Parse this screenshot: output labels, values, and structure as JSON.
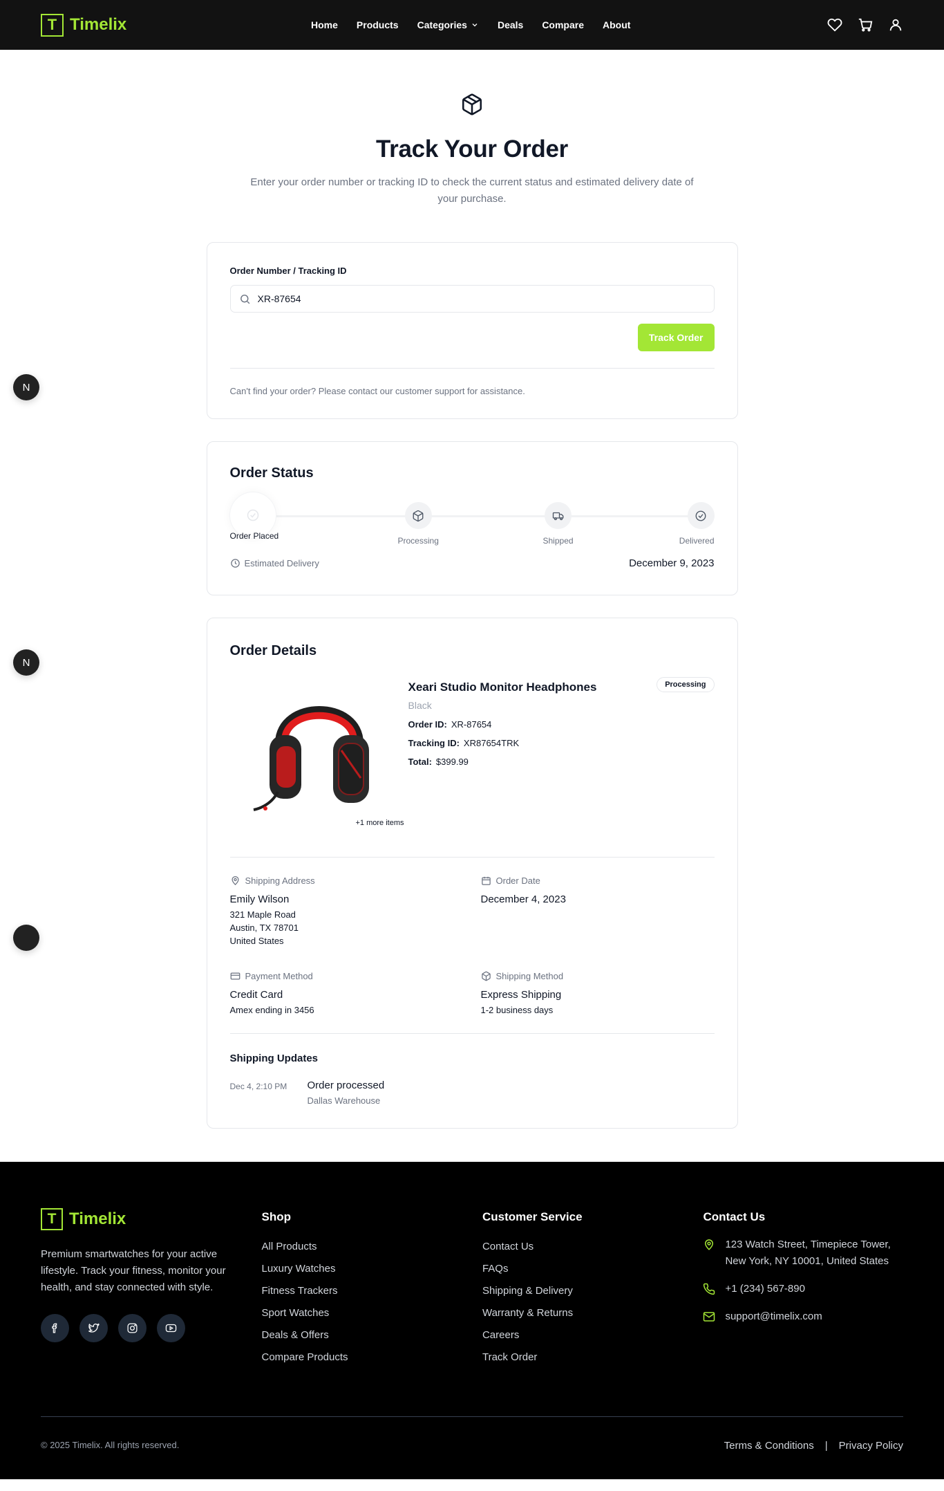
{
  "nav": {
    "brand_letter": "T",
    "brand_name": "Timelix",
    "links": [
      "Home",
      "Products",
      "Categories",
      "Deals",
      "Compare",
      "About"
    ],
    "icons": [
      "heart-icon",
      "cart-icon",
      "user-icon"
    ]
  },
  "hero": {
    "icon": "package-icon",
    "title": "Track Your Order",
    "subtitle": "Enter your order number or tracking ID to check the current status and estimated delivery date of your purchase."
  },
  "search": {
    "label": "Order Number / Tracking ID",
    "value": "XR-87654",
    "button": "Track Order",
    "help": "Can't find your order? Please contact our customer support for assistance."
  },
  "status": {
    "title": "Order Status",
    "steps": [
      "Order Placed",
      "Processing",
      "Shipped",
      "Delivered"
    ],
    "eta_label": "Estimated Delivery",
    "eta_date": "December 9, 2023"
  },
  "details": {
    "title": "Order Details",
    "product_name": "Xeari Studio Monitor Headphones",
    "variant": "Black",
    "badge": "Processing",
    "more_items": "+1 more items",
    "order_id_label": "Order ID:",
    "order_id": "XR-87654",
    "tracking_label": "Tracking ID:",
    "tracking_id": "XR87654TRK",
    "total_label": "Total:",
    "total": "$399.99",
    "shipping_address": {
      "label": "Shipping Address",
      "name": "Emily Wilson",
      "line1": "321 Maple Road",
      "line2": "Austin, TX 78701",
      "line3": "United States"
    },
    "order_date": {
      "label": "Order Date",
      "value": "December 4, 2023"
    },
    "payment": {
      "label": "Payment Method",
      "method": "Credit Card",
      "detail": "Amex ending in 3456"
    },
    "shipping_method": {
      "label": "Shipping Method",
      "method": "Express Shipping",
      "detail": "1-2 business days"
    },
    "updates_title": "Shipping Updates",
    "updates": [
      {
        "time": "Dec 4, 2:10 PM",
        "title": "Order processed",
        "location": "Dallas Warehouse"
      }
    ]
  },
  "floating": [
    "N",
    "N",
    ""
  ],
  "footer": {
    "brand_letter": "T",
    "brand_name": "Timelix",
    "description": "Premium smartwatches for your active lifestyle. Track your fitness, monitor your health, and stay connected with style.",
    "socials": [
      "facebook-icon",
      "twitter-icon",
      "instagram-icon",
      "youtube-icon"
    ],
    "shop": {
      "title": "Shop",
      "links": [
        "All Products",
        "Luxury Watches",
        "Fitness Trackers",
        "Sport Watches",
        "Deals & Offers",
        "Compare Products"
      ]
    },
    "service": {
      "title": "Customer Service",
      "links": [
        "Contact Us",
        "FAQs",
        "Shipping & Delivery",
        "Warranty & Returns",
        "Careers",
        "Track Order"
      ]
    },
    "contact": {
      "title": "Contact Us",
      "address": "123 Watch Street, Timepiece Tower, New York, NY 10001, United States",
      "phone": "+1 (234) 567-890",
      "email": "support@timelix.com"
    },
    "copyright": "© 2025 Timelix. All rights reserved.",
    "terms": "Terms & Conditions",
    "separator": "|",
    "privacy": "Privacy Policy"
  },
  "colors": {
    "accent": "#a3e635",
    "nav_bg": "#121212",
    "footer_bg": "#000000"
  }
}
